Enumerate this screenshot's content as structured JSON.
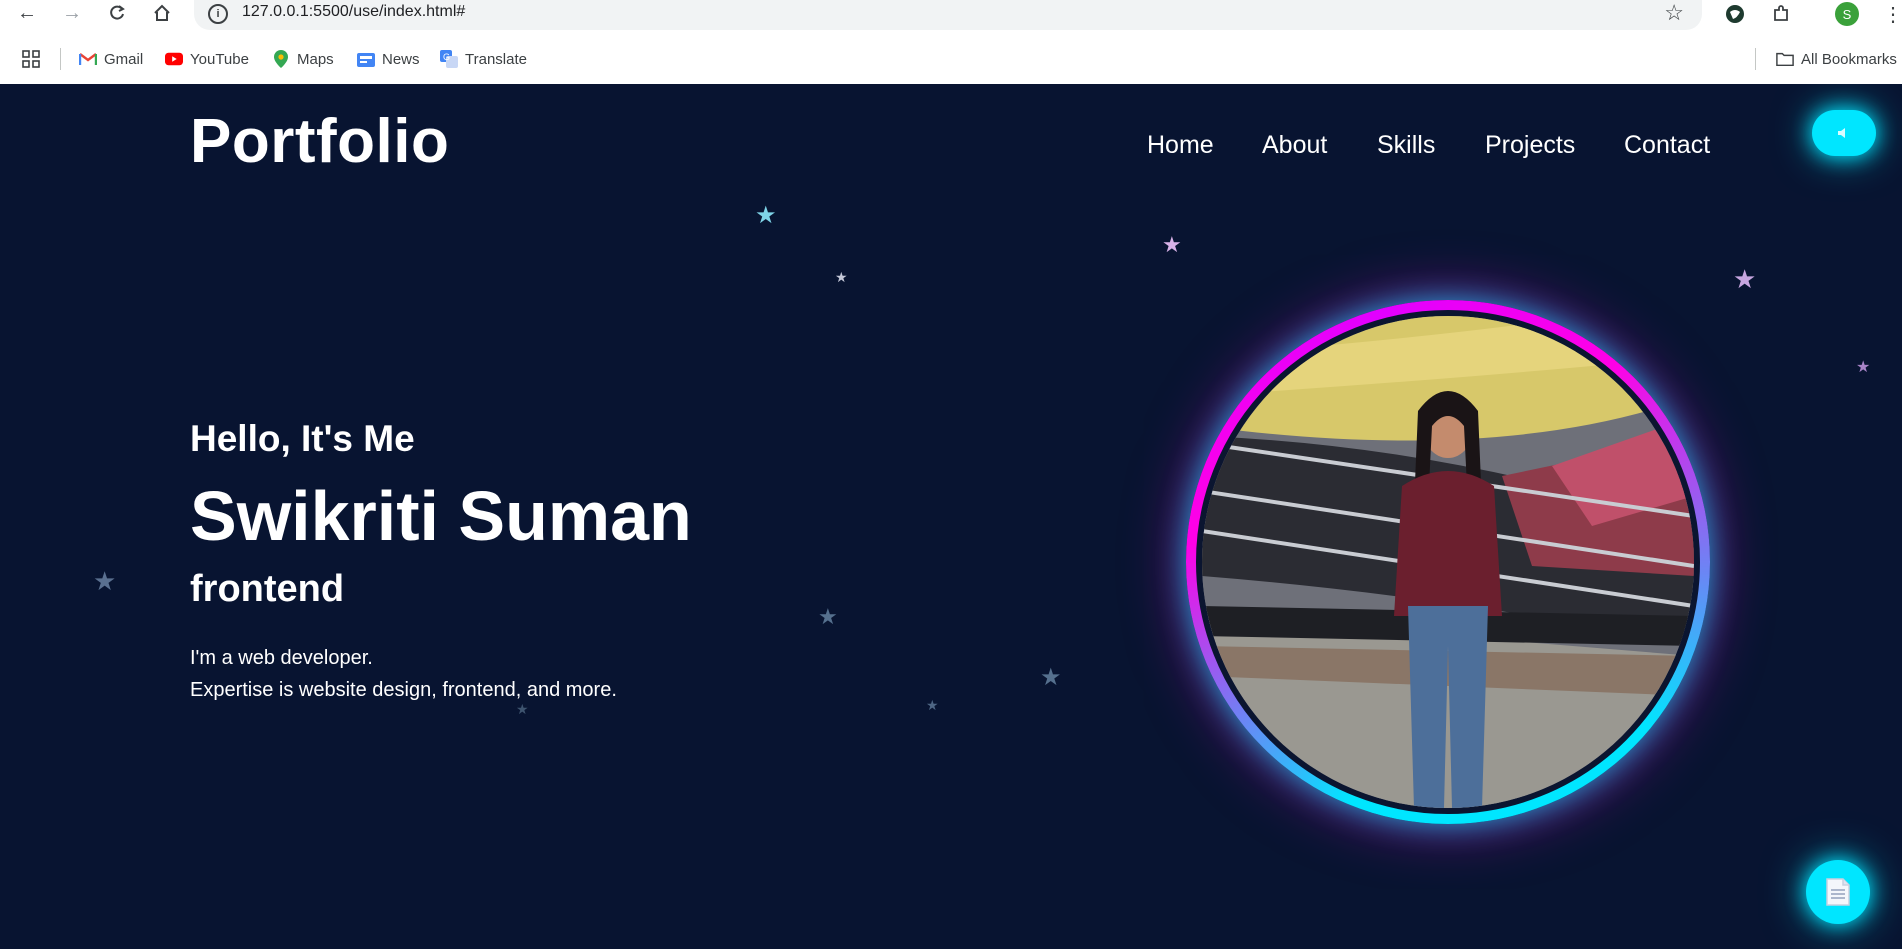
{
  "browser": {
    "url": "127.0.0.1:5500/use/index.html#",
    "profile_initial": "S",
    "bookmarks": [
      {
        "label": "Gmail",
        "icon": "gmail-icon"
      },
      {
        "label": "YouTube",
        "icon": "youtube-icon"
      },
      {
        "label": "Maps",
        "icon": "maps-icon"
      },
      {
        "label": "News",
        "icon": "news-icon"
      },
      {
        "label": "Translate",
        "icon": "translate-icon"
      }
    ],
    "all_bookmarks": "All Bookmarks"
  },
  "site": {
    "logo": "Portfolio",
    "nav": [
      "Home",
      "About",
      "Skills",
      "Projects",
      "Contact"
    ],
    "hero": {
      "greeting": "Hello, It's Me",
      "name": "Swikriti Suman",
      "role": "frontend",
      "desc_line1": "I'm a web developer.",
      "desc_line2": "Expertise is website design, frontend, and more."
    },
    "colors": {
      "background": "#081431",
      "accent_cyan": "#00e6ff",
      "accent_magenta": "#ff00e6"
    }
  }
}
